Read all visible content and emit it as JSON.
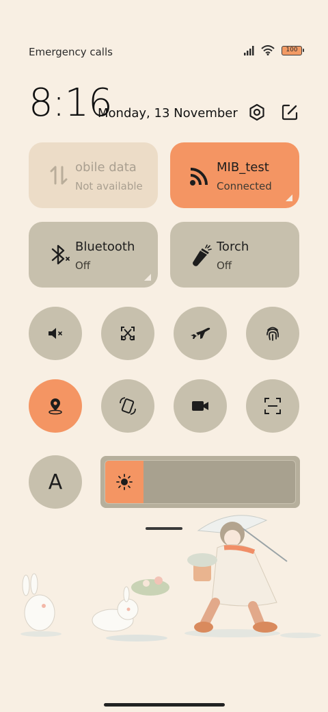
{
  "status_bar": {
    "carrier_text": "Emergency calls o",
    "battery_level": "100",
    "signal_icon": "signal-icon",
    "wifi_icon": "wifi-icon"
  },
  "header": {
    "time": "8:16",
    "date": "Monday, 13 November"
  },
  "tiles": {
    "mobile_data": {
      "title": "obile data",
      "subtitle": "Not available"
    },
    "wifi": {
      "title": "MIB_test",
      "subtitle": "Connected"
    },
    "bluetooth": {
      "title": "Bluetooth",
      "subtitle": "Off"
    },
    "torch": {
      "title": "Torch",
      "subtitle": "Off"
    }
  },
  "toggles_row1": [
    "mute-icon",
    "screenshot-icon",
    "airplane-icon",
    "fingerprint-icon"
  ],
  "toggles_row2": [
    "location-icon",
    "auto-rotate-icon",
    "video-record-icon",
    "scanner-icon"
  ],
  "font_button": {
    "label": "A"
  },
  "brightness": {
    "level": 0.2
  },
  "colors": {
    "background": "#f8efe3",
    "accent": "#f49563",
    "tile_inactive": "#c7c0ad",
    "tile_unavailable": "#ecdcc7"
  }
}
